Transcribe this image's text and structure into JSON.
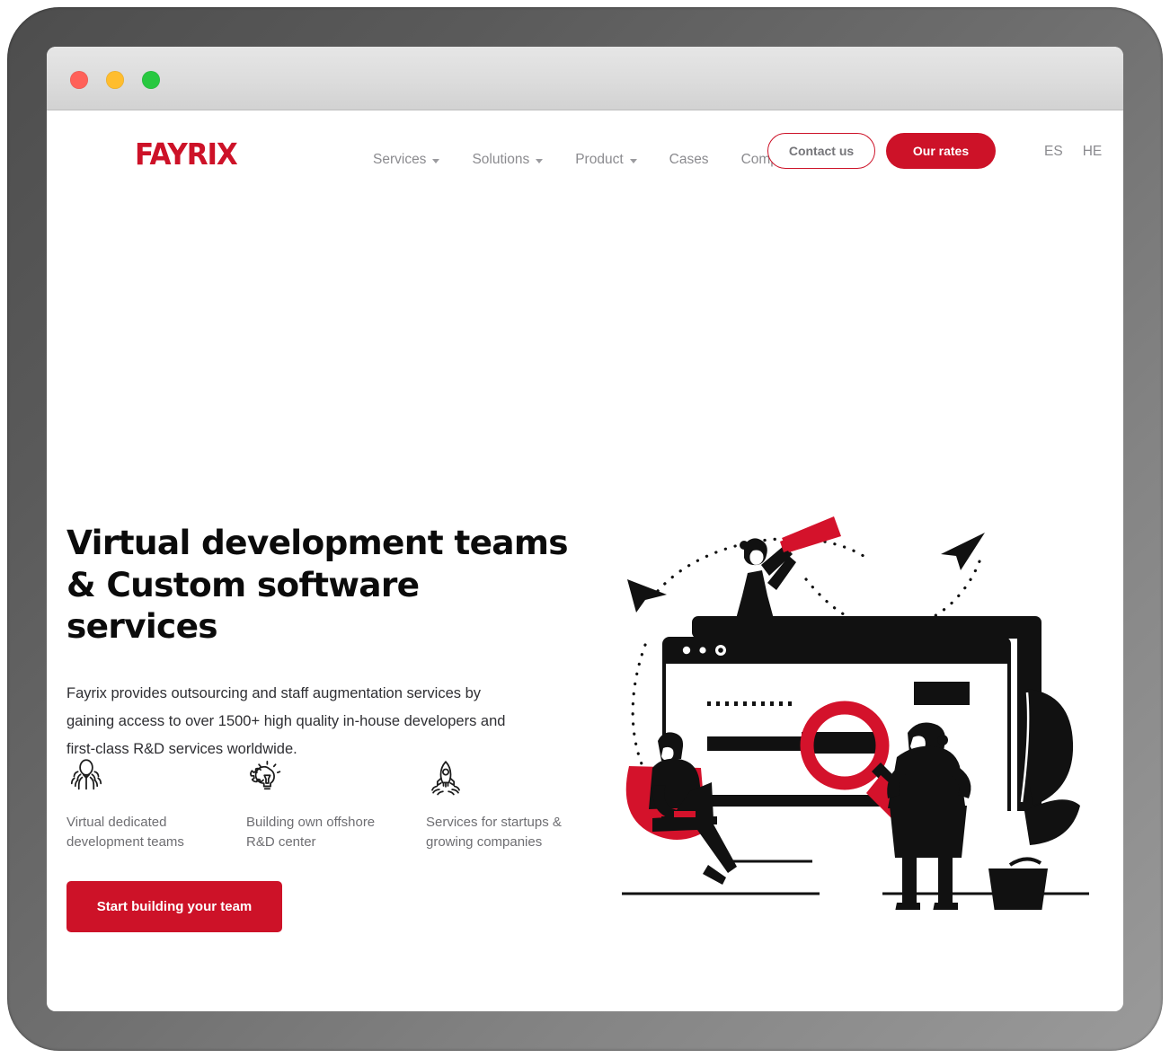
{
  "window": {
    "traffic_lights": [
      {
        "name": "close",
        "color": "#ff6159"
      },
      {
        "name": "minimize",
        "color": "#ffbd2e"
      },
      {
        "name": "maximize",
        "color": "#28c840"
      }
    ]
  },
  "theme": {
    "brand_red": "#cd1228",
    "text_dark": "#0b0b0b",
    "text_muted": "#8b8b8f"
  },
  "header": {
    "logo_text": "FAYRIX",
    "nav": [
      {
        "label": "Services",
        "has_dropdown": true
      },
      {
        "label": "Solutions",
        "has_dropdown": true
      },
      {
        "label": "Product",
        "has_dropdown": true
      },
      {
        "label": "Cases",
        "has_dropdown": false
      },
      {
        "label": "Company",
        "has_dropdown": true
      }
    ],
    "contact_label": "Contact us",
    "rates_label": "Our rates",
    "languages": [
      "ES",
      "HE"
    ]
  },
  "hero": {
    "title": "Virtual development teams\n& Custom software services",
    "subtitle": "Fayrix provides outsourcing and staff augmentation services by gaining access to over 1500+ high quality in-house developers and first-class R&D services worldwide.",
    "cta_label": "Start building your team",
    "features": [
      {
        "icon": "team-icon",
        "label": "Virtual dedicated\ndevelopment teams"
      },
      {
        "icon": "lightbulb-gear-icon",
        "label": "Building own offshore\nR&D center"
      },
      {
        "icon": "rocket-icon",
        "label": "Services for startups &\ngrowing companies"
      }
    ],
    "illustration_alt": "Woman with telescope on a browser window, man on bean bag with laptop, woman with magnifying glass"
  }
}
